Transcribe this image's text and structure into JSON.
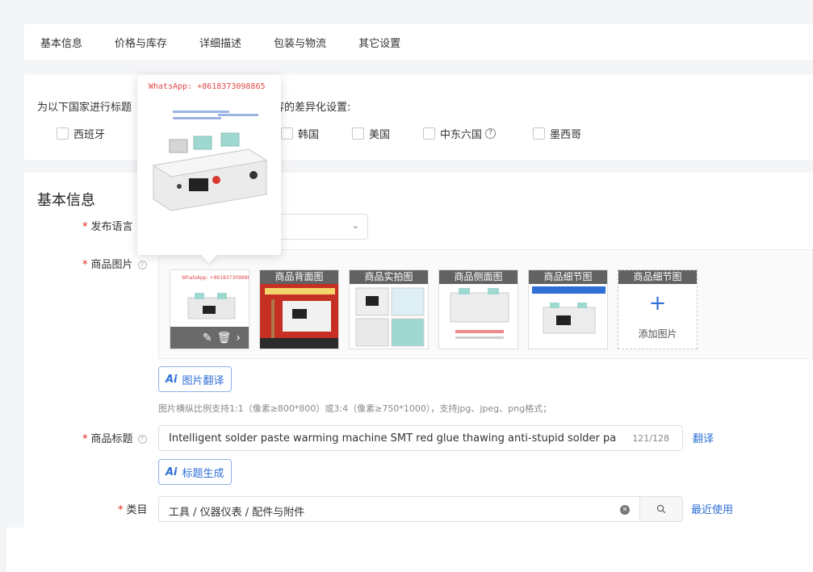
{
  "tabs": [
    "基本信息",
    "价格与库存",
    "详细描述",
    "包装与物流",
    "其它设置"
  ],
  "country": {
    "title": "为以下国家进行标题",
    "title_tail": "容的差异化设置:",
    "options": [
      "西班牙",
      "韩国",
      "美国",
      "中东六国",
      "墨西哥"
    ]
  },
  "basic": {
    "section_title": "基本信息",
    "lang_label": "发布语言",
    "images_label": "商品图片",
    "image_labels": [
      "商品背面图",
      "商品实拍图",
      "商品侧面图",
      "商品细节图",
      "商品细节图"
    ],
    "add_image": "添加图片",
    "ai_translate": "图片翻译",
    "ai_mark": "Ai",
    "hint": "图片横纵比例支持1:1（像素≥800*800）或3:4（像素≥750*1000），支持jpg、jpeg、png格式；",
    "title_label": "商品标题",
    "title_value": "Intelligent solder paste warming machine SMT red glue thawing anti-stupid solder paste warmer",
    "title_count": "121/128",
    "translate_link": "翻译",
    "ai_title": "标题生成",
    "category_label": "类目",
    "category_value": "工具 / 仪器仪表 / 配件与附件",
    "recent_link": "最近使用"
  },
  "popover": {
    "brand": "WhatsApp: +8618373098865"
  },
  "icons": [
    "edit-icon",
    "delete-icon",
    "chevron-right-icon",
    "search-icon",
    "clear-icon",
    "help-icon",
    "chevron-down-icon"
  ]
}
